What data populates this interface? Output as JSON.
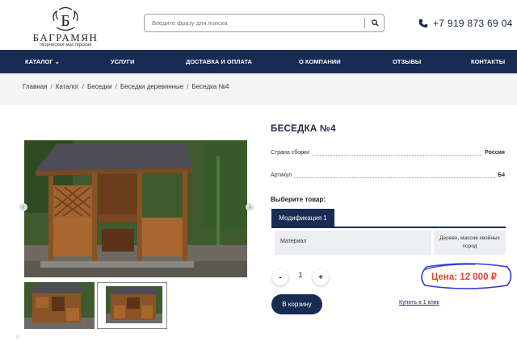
{
  "brand": {
    "logo_letter": "Б",
    "name": "БАГРАМЯН",
    "tagline": "творческая мастерская"
  },
  "search": {
    "placeholder": "Введите фразу для поиска",
    "icon": "search-icon"
  },
  "contacts": {
    "phone": "+7 919 873 69 04",
    "icon": "phone-icon"
  },
  "nav": {
    "items": [
      {
        "label": "Каталог ⌄"
      },
      {
        "label": "Услуги"
      },
      {
        "label": "Доставка и оплата"
      },
      {
        "label": "О компании"
      },
      {
        "label": "Отзывы"
      },
      {
        "label": "Контакты"
      }
    ]
  },
  "breadcrumbs": [
    "Главная",
    "Каталог",
    "Беседки",
    "Беседки деревянные",
    "Беседка №4"
  ],
  "product": {
    "title": "БЕСЕДКА №4",
    "properties": [
      {
        "label": "Страна сборки",
        "value": "Россия"
      },
      {
        "label": "Артикул",
        "value": "Б4"
      }
    ],
    "choose_label": "Выберите товар:",
    "tab_label": "Модификация 1",
    "attribute": {
      "name": "Материал",
      "value": "Дерево, массив хвойных пород"
    },
    "quantity": {
      "minus": "-",
      "value": "1",
      "plus": "+"
    },
    "price": "Цена: 12 000 ₽",
    "cart_button": "В корзину",
    "one_click": "Купить в 1 клик"
  },
  "gallery": {
    "prev_arrow": "‹",
    "next_arrow": "›",
    "thumbnails": 2,
    "active_thumbnail": 2
  },
  "colors": {
    "brand_navy": "#182b53",
    "price_red": "#e0462d",
    "highlight_circle": "#2f3bd6"
  }
}
